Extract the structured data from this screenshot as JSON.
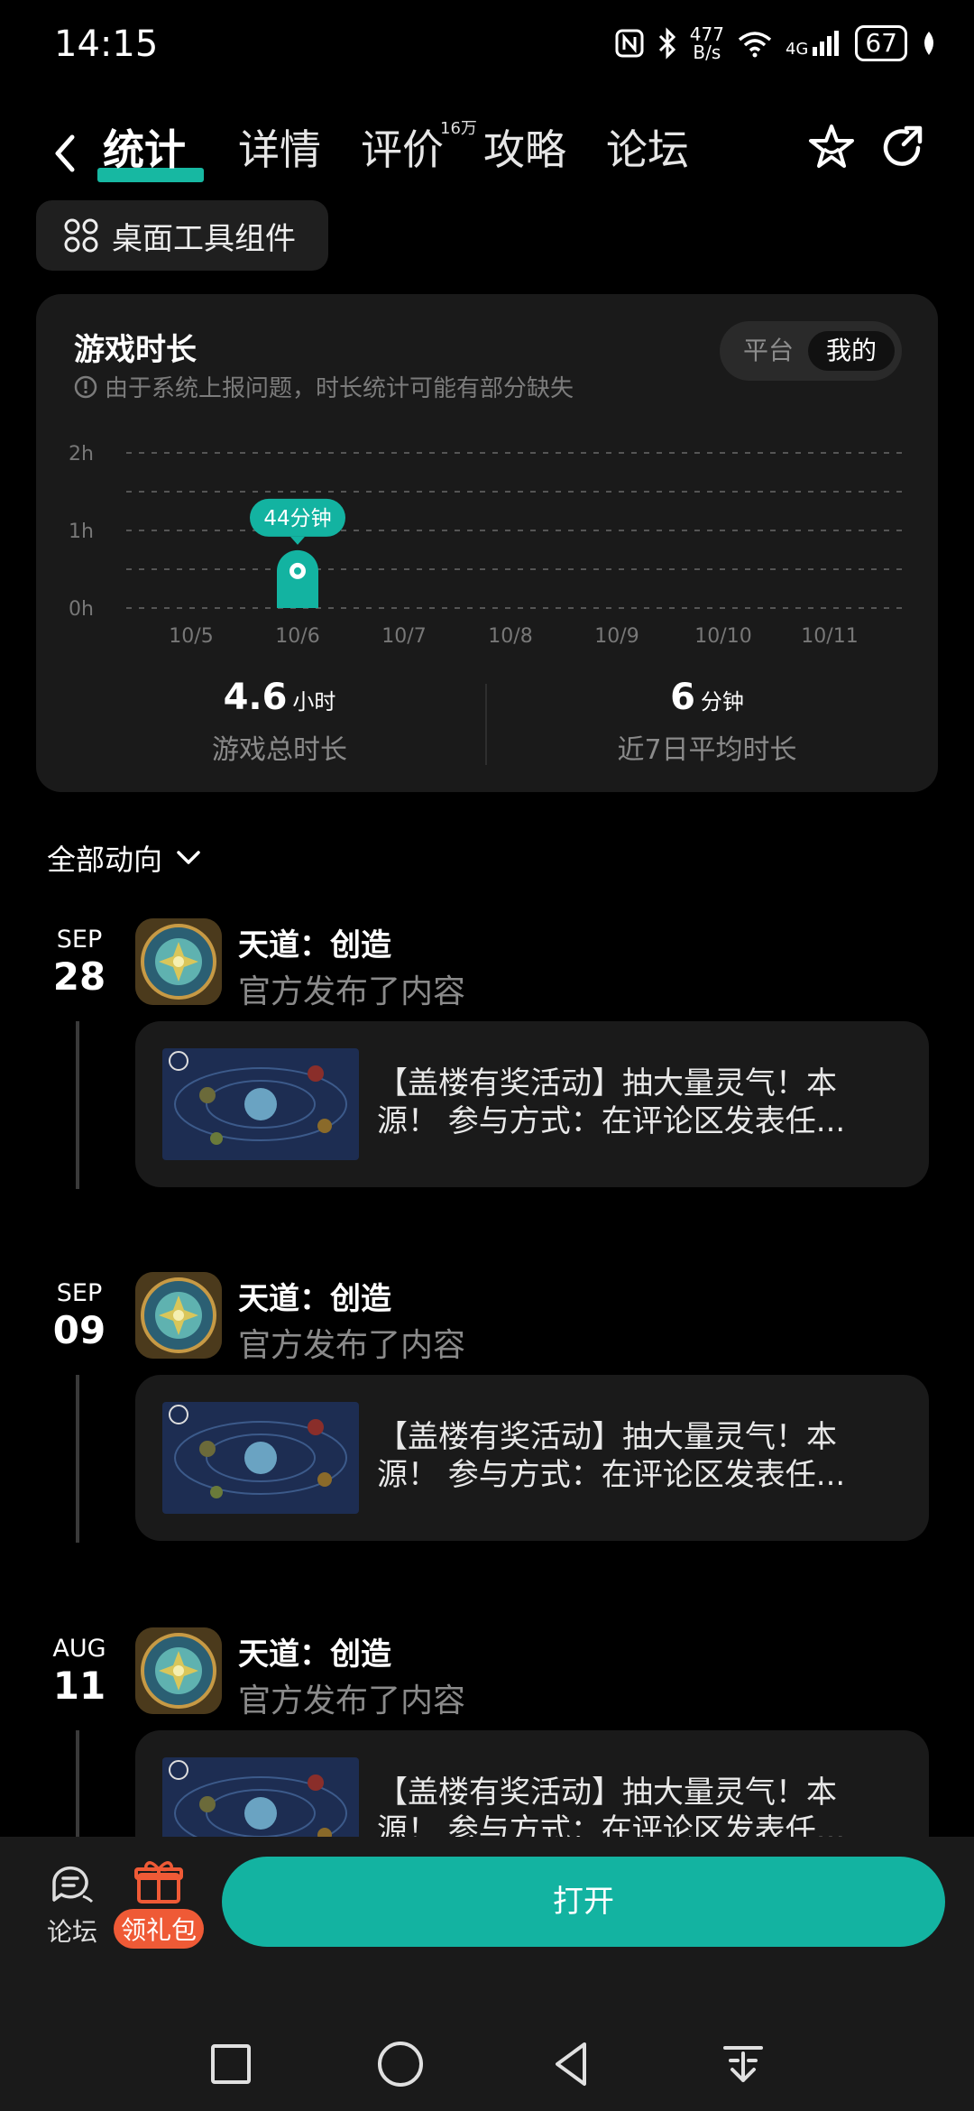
{
  "status_bar": {
    "time": "14:15",
    "net_speed_value": "477",
    "net_speed_unit": "B/s",
    "network": "4G",
    "battery": "67"
  },
  "nav": {
    "tabs": [
      {
        "label": "统计",
        "active": true
      },
      {
        "label": "详情",
        "active": false
      },
      {
        "label": "评价",
        "active": false,
        "badge": "16万"
      },
      {
        "label": "攻略",
        "active": false
      },
      {
        "label": "论坛",
        "active": false
      }
    ]
  },
  "widget_button": {
    "label": "桌面工具组件"
  },
  "stats_card": {
    "title": "游戏时长",
    "note": "由于系统上报问题，时长统计可能有部分缺失",
    "toggle": {
      "options": [
        "平台",
        "我的"
      ],
      "selected": "我的"
    },
    "totals": [
      {
        "value": "4.6",
        "unit": "小时",
        "caption": "游戏总时长"
      },
      {
        "value": "6",
        "unit": "分钟",
        "caption": "近7日平均时长"
      }
    ]
  },
  "chart_data": {
    "type": "bar",
    "categories": [
      "10/5",
      "10/6",
      "10/7",
      "10/8",
      "10/9",
      "10/10",
      "10/11"
    ],
    "values": [
      0,
      44,
      0,
      0,
      0,
      0,
      0
    ],
    "value_unit": "分钟",
    "yticks": [
      "0h",
      "1h",
      "2h"
    ],
    "ylim_minutes": [
      0,
      120
    ],
    "highlight_index": 1,
    "highlight_label": "44分钟",
    "grid": true,
    "colors": {
      "bar": "#13b3a1",
      "grid": "#555555"
    }
  },
  "feed": {
    "filter_label": "全部动向",
    "posts": [
      {
        "month": "SEP",
        "day": "28",
        "name": "天道：创造",
        "action": "官方发布了内容",
        "text": "【盖楼有奖活动】抽大量灵气！本源！ 参与方式：在评论区发表任..."
      },
      {
        "month": "SEP",
        "day": "09",
        "name": "天道：创造",
        "action": "官方发布了内容",
        "text": "【盖楼有奖活动】抽大量灵气！本源！ 参与方式：在评论区发表任..."
      },
      {
        "month": "AUG",
        "day": "11",
        "name": "天道：创造",
        "action": "官方发布了内容",
        "text": "【盖楼有奖活动】抽大量灵气！本源！ 参与方式：在评论区发表任..."
      }
    ]
  },
  "bottom_bar": {
    "forum_label": "论坛",
    "gift_label": "领礼包",
    "open_label": "打开"
  }
}
